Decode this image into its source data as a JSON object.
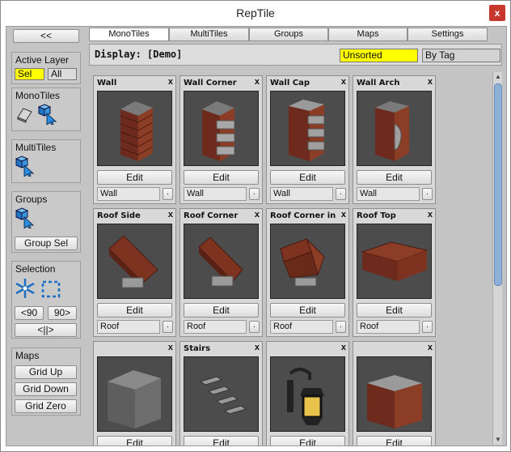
{
  "window": {
    "title": "RepTile",
    "close_label": "x"
  },
  "sidebar": {
    "back_label": "<<",
    "active_layer": {
      "title": "Active Layer",
      "sel_label": "Sel",
      "all_label": "All"
    },
    "monotiles": {
      "title": "MonoTiles",
      "icons": [
        "eraser-icon",
        "cube-select-icon"
      ]
    },
    "multitiles": {
      "title": "MultiTiles",
      "icons": [
        "cube-select-icon"
      ]
    },
    "groups": {
      "title": "Groups",
      "group_sel_label": "Group Sel",
      "icons": [
        "cube-select-icon"
      ]
    },
    "selection": {
      "title": "Selection",
      "icons": [
        "snowflake-icon",
        "marquee-select-icon"
      ],
      "rotate_left_label": "<90",
      "rotate_right_label": "90>",
      "mirror_label": "<||>"
    },
    "maps": {
      "title": "Maps",
      "grid_up_label": "Grid Up",
      "grid_down_label": "Grid Down",
      "grid_zero_label": "Grid Zero"
    }
  },
  "tabs": [
    {
      "label": "MonoTiles",
      "active": true
    },
    {
      "label": "MultiTiles",
      "active": false
    },
    {
      "label": "Groups",
      "active": false
    },
    {
      "label": "Maps",
      "active": false
    },
    {
      "label": "Settings",
      "active": false
    }
  ],
  "display": {
    "label": "Display: [Demo]",
    "unsorted_label": "Unsorted",
    "bytag_label": "By Tag",
    "unsorted_color": "#ffff00"
  },
  "tiles": [
    {
      "name": "Wall",
      "tag": "Wall",
      "edit_label": "Edit",
      "close": "x",
      "tag_button": "."
    },
    {
      "name": "Wall Corner",
      "tag": "Wall",
      "edit_label": "Edit",
      "close": "x",
      "tag_button": "."
    },
    {
      "name": "Wall Cap",
      "tag": "Wall",
      "edit_label": "Edit",
      "close": "x",
      "tag_button": "."
    },
    {
      "name": "Wall Arch",
      "tag": "Wall",
      "edit_label": "Edit",
      "close": "x",
      "tag_button": "."
    },
    {
      "name": "Roof Side",
      "tag": "Roof",
      "edit_label": "Edit",
      "close": "x",
      "tag_button": "."
    },
    {
      "name": "Roof Corner",
      "tag": "Roof",
      "edit_label": "Edit",
      "close": "x",
      "tag_button": "."
    },
    {
      "name": "Roof Corner inn",
      "tag": "Roof",
      "edit_label": "Edit",
      "close": "x",
      "tag_button": "."
    },
    {
      "name": "Roof Top",
      "tag": "Roof",
      "edit_label": "Edit",
      "close": "x",
      "tag_button": "."
    },
    {
      "name": "",
      "tag": "",
      "edit_label": "Edit",
      "close": "x",
      "tag_button": "."
    },
    {
      "name": "Stairs",
      "tag": "",
      "edit_label": "Edit",
      "close": "x",
      "tag_button": "."
    },
    {
      "name": "",
      "tag": "",
      "edit_label": "Edit",
      "close": "x",
      "tag_button": "."
    },
    {
      "name": "",
      "tag": "",
      "edit_label": "Edit",
      "close": "x",
      "tag_button": "."
    }
  ]
}
